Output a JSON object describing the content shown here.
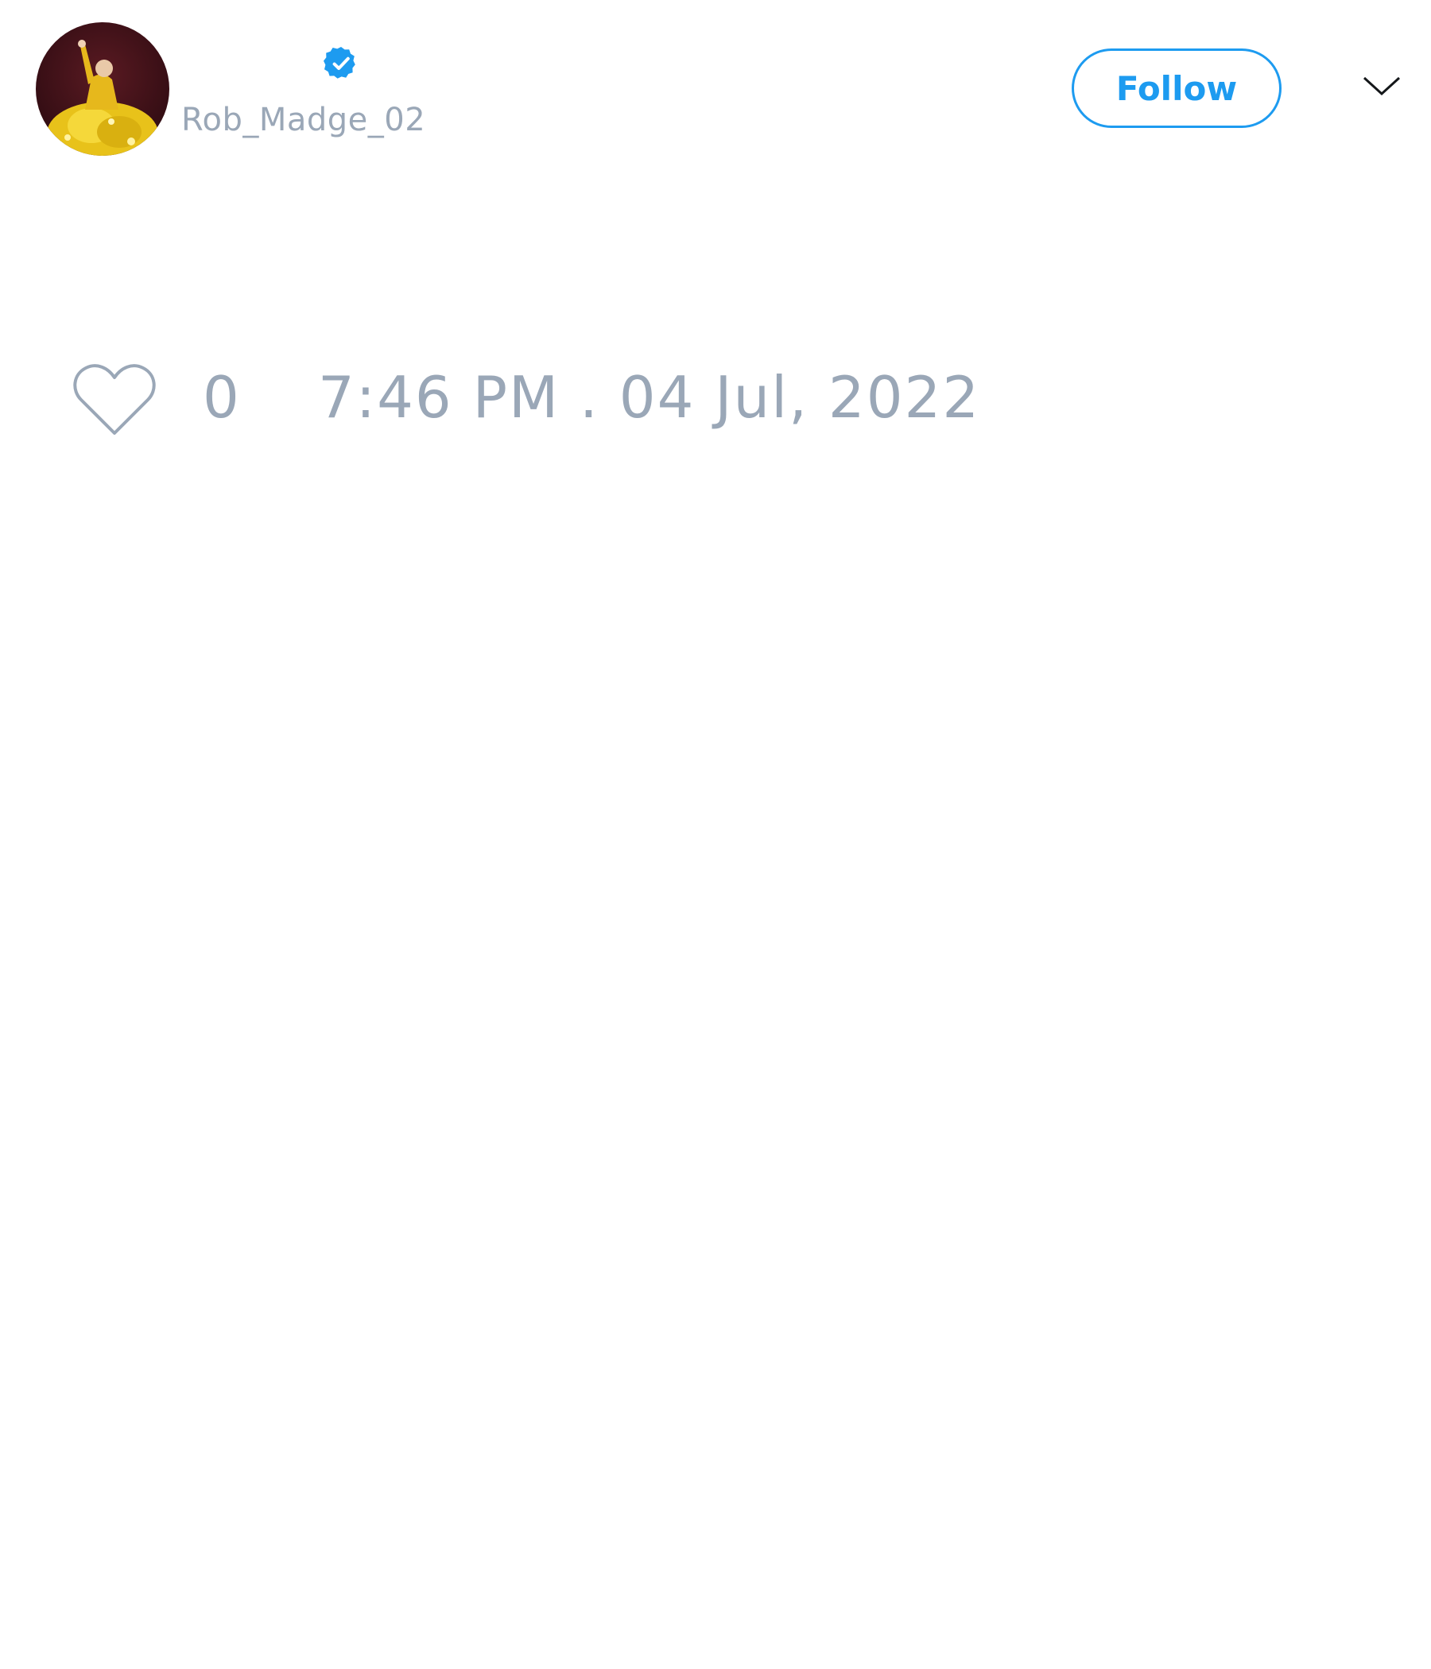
{
  "user": {
    "display_name": "",
    "username": "Rob_Madge_02",
    "verified": true,
    "avatar_icon": "avatar-photo-yellow-dress"
  },
  "actions": {
    "follow_label": "Follow",
    "more_icon": "chevron-down-icon",
    "like_icon": "heart-outline-icon"
  },
  "stats": {
    "like_count": "0",
    "timestamp": "7:46 PM . 04 Jul, 2022"
  },
  "colors": {
    "accent": "#1d9bf0",
    "muted_text": "#9aa7b7",
    "background": "#ffffff"
  }
}
